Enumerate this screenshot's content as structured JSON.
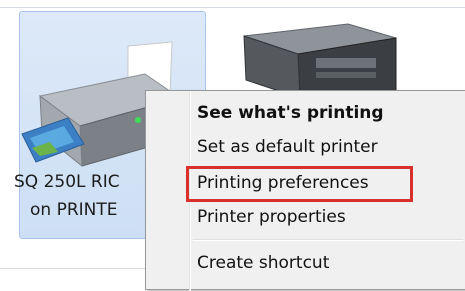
{
  "devices": [
    {
      "name_line1": "SQ 250L RIC",
      "name_line2": "on PRINTE",
      "icon": "printer-icon",
      "selected": true
    },
    {
      "icon": "multifunction-printer-icon",
      "selected": false
    }
  ],
  "context_menu": {
    "items": [
      {
        "label": "See what's printing",
        "bold": true
      },
      {
        "label": "Set as default printer",
        "bold": false
      },
      {
        "label": "Printing preferences",
        "bold": false,
        "highlighted": true
      },
      {
        "label": "Printer properties",
        "bold": false
      },
      {
        "label": "Create shortcut",
        "bold": false
      }
    ]
  },
  "colors": {
    "selection_bg": "#cddff4",
    "selection_border": "#a9c6ea",
    "menu_bg": "#f0f0f0",
    "highlight_border": "#d9302c"
  }
}
